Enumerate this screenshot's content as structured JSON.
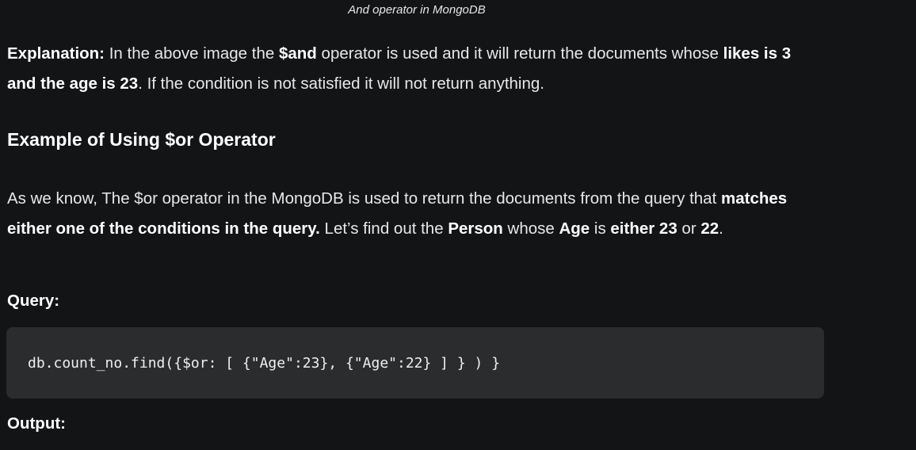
{
  "caption": "And operator in MongoDB",
  "explanation": {
    "label": "Explanation:",
    "t1": " In the above image the ",
    "b1": "$and",
    "t2": " operator is used and it will return the documents whose ",
    "b2": "likes is 3 and the age is 23",
    "t3": ". If the condition is not satisfied it will not return anything."
  },
  "section_heading": "Example of Using $or Operator",
  "intro": {
    "t1": "As we know, The $or operator in the MongoDB is used to return the documents from the query that ",
    "b1": "matches either one of the conditions in the query.",
    "t2": " Let’s find out the ",
    "b2": "Person",
    "t3": " whose ",
    "b3": "Age",
    "t4": " is ",
    "b4": "either 23",
    "t5": " or ",
    "b5": "22",
    "t6": "."
  },
  "query_label": "Query:",
  "code": "db.count_no.find({$or: [ {\"Age\":23}, {\"Age\":22} ] } ) }",
  "output_label": "Output:"
}
